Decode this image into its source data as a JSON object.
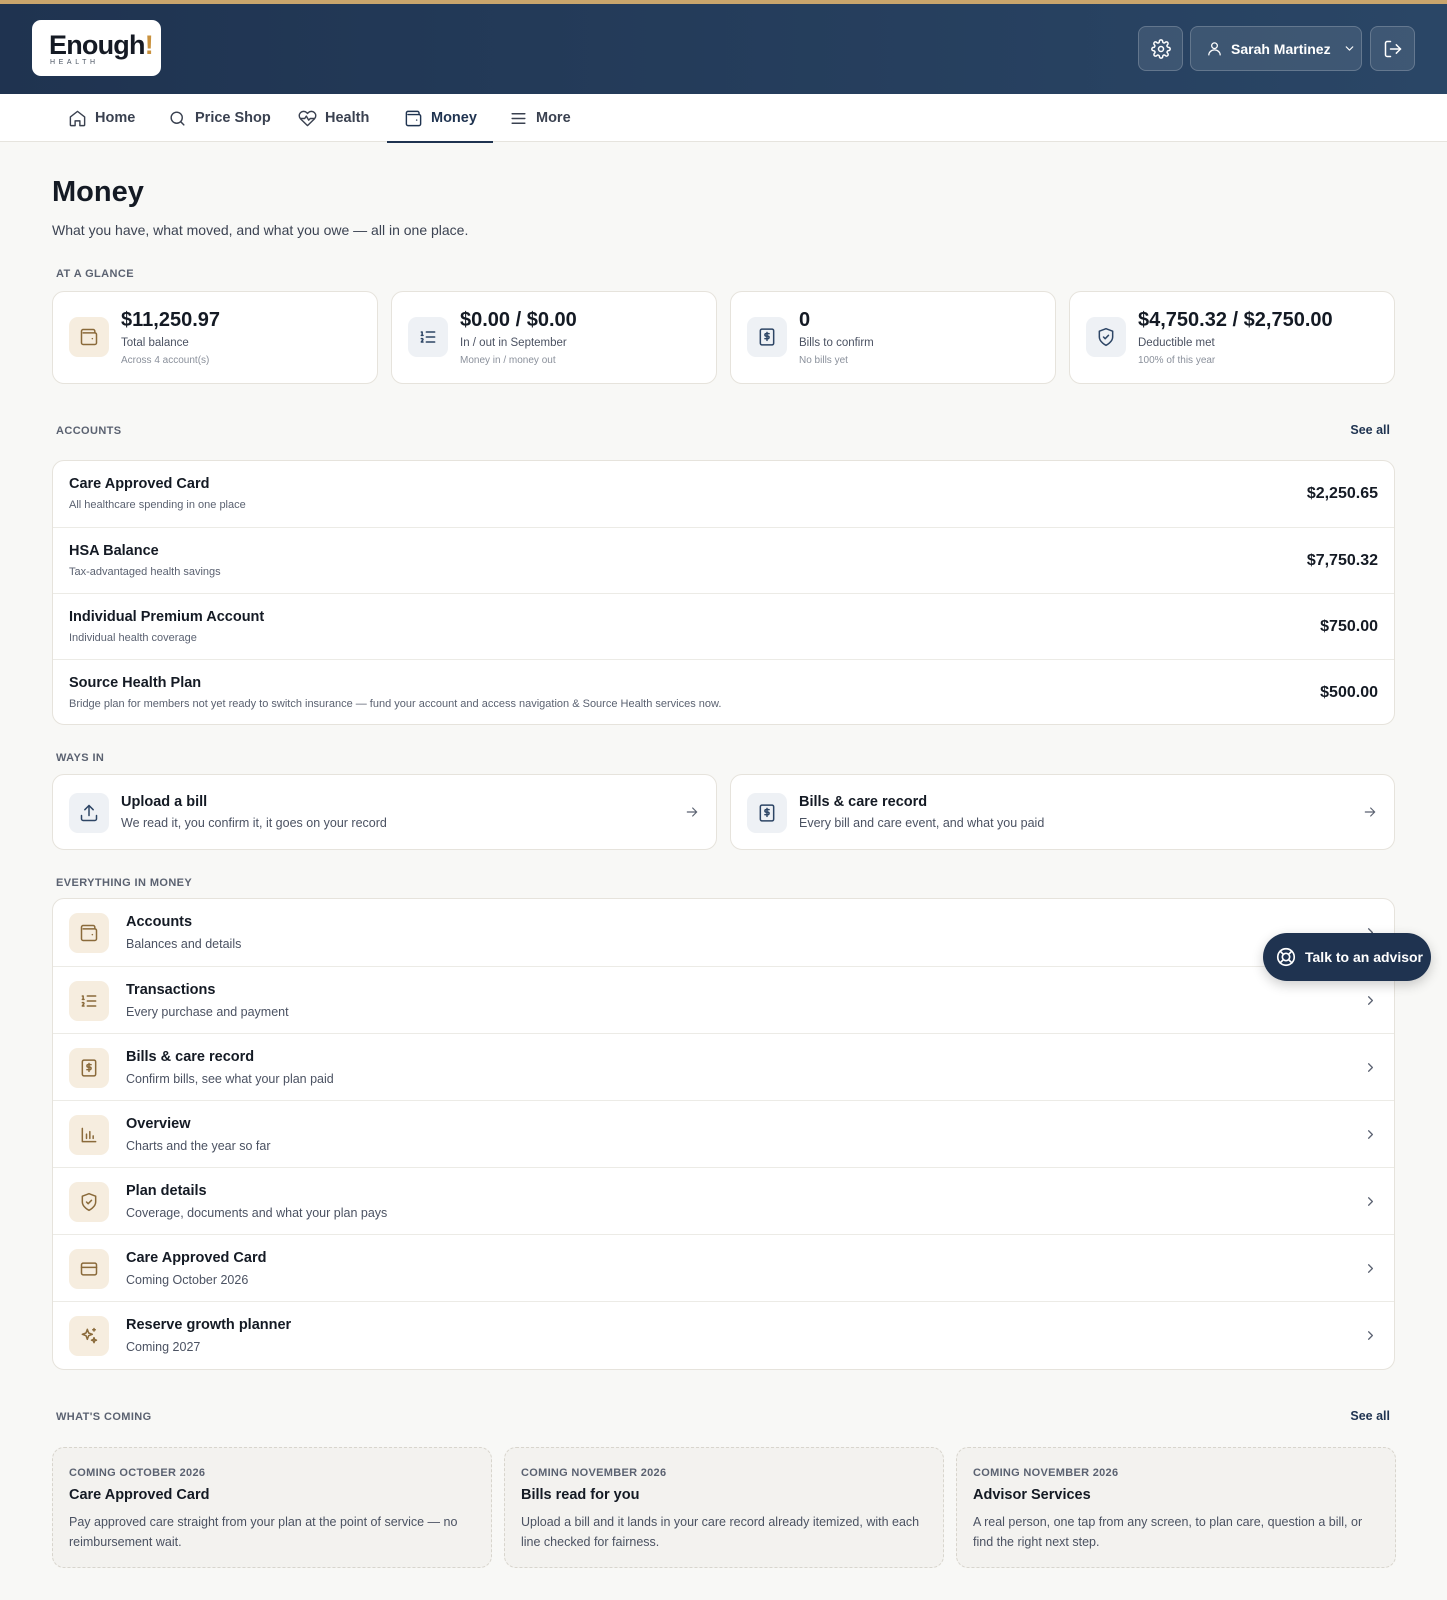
{
  "header": {
    "logo_word": "Enough",
    "logo_bang": "!",
    "logo_sub": "HEALTH",
    "user_name": "Sarah Martinez"
  },
  "nav": {
    "items": [
      {
        "label": "Home",
        "icon": "home-icon"
      },
      {
        "label": "Price Shop",
        "icon": "search-icon"
      },
      {
        "label": "Health",
        "icon": "heart-pulse-icon"
      },
      {
        "label": "Money",
        "icon": "wallet-icon",
        "active": true
      },
      {
        "label": "More",
        "icon": "menu-icon"
      }
    ]
  },
  "page": {
    "title": "Money",
    "subtitle": "What you have, what moved, and what you owe — all in one place."
  },
  "glance": {
    "label": "AT A GLANCE",
    "cards": [
      {
        "value": "$11,250.97",
        "label": "Total balance",
        "sub": "Across 4 account(s)",
        "icon": "wallet-icon"
      },
      {
        "value": "$0.00 / $0.00",
        "label": "In / out in September",
        "sub": "Money in / money out",
        "icon": "list-icon"
      },
      {
        "value": "0",
        "label": "Bills to confirm",
        "sub": "No bills yet",
        "icon": "receipt-icon"
      },
      {
        "value": "$4,750.32 / $2,750.00",
        "label": "Deductible met",
        "sub": "100% of this year",
        "icon": "shield-check-icon"
      }
    ]
  },
  "accounts": {
    "label": "ACCOUNTS",
    "see_all": "See all",
    "rows": [
      {
        "name": "Care Approved Card",
        "desc": "All healthcare spending in one place",
        "amount": "$2,250.65"
      },
      {
        "name": "HSA Balance",
        "desc": "Tax-advantaged health savings",
        "amount": "$7,750.32"
      },
      {
        "name": "Individual Premium Account",
        "desc": "Individual health coverage",
        "amount": "$750.00"
      },
      {
        "name": "Source Health Plan",
        "desc": "Bridge plan for members not yet ready to switch insurance — fund your account and access navigation & Source Health services now.",
        "amount": "$500.00"
      }
    ]
  },
  "ways_in": {
    "label": "WAYS IN",
    "cards": [
      {
        "title": "Upload a bill",
        "sub": "We read it, you confirm it, it goes on your record",
        "icon": "upload-icon"
      },
      {
        "title": "Bills & care record",
        "sub": "Every bill and care event, and what you paid",
        "icon": "receipt-icon"
      }
    ]
  },
  "everything": {
    "label": "EVERYTHING IN MONEY",
    "rows": [
      {
        "title": "Accounts",
        "sub": "Balances and details",
        "icon": "wallet-icon"
      },
      {
        "title": "Transactions",
        "sub": "Every purchase and payment",
        "icon": "list-icon"
      },
      {
        "title": "Bills & care record",
        "sub": "Confirm bills, see what your plan paid",
        "icon": "receipt-icon"
      },
      {
        "title": "Overview",
        "sub": "Charts and the year so far",
        "icon": "bar-chart-icon"
      },
      {
        "title": "Plan details",
        "sub": "Coverage, documents and what your plan pays",
        "icon": "shield-check-icon"
      },
      {
        "title": "Care Approved Card",
        "sub": "Coming October 2026",
        "icon": "credit-card-icon"
      },
      {
        "title": "Reserve growth planner",
        "sub": "Coming 2027",
        "icon": "sparkles-icon"
      }
    ]
  },
  "advisor": {
    "label": "Talk to an advisor",
    "icon": "lifebuoy-icon"
  },
  "coming": {
    "label": "WHAT'S COMING",
    "see_all": "See all",
    "cards": [
      {
        "when": "COMING OCTOBER 2026",
        "title": "Care Approved Card",
        "desc": "Pay approved care straight from your plan at the point of service — no reimbursement wait."
      },
      {
        "when": "COMING NOVEMBER 2026",
        "title": "Bills read for you",
        "desc": "Upload a bill and it lands in your care record already itemized, with each line checked for fairness."
      },
      {
        "when": "COMING NOVEMBER 2026",
        "title": "Advisor Services",
        "desc": "A real person, one tap from any screen, to plan care, question a bill, or find the right next step."
      }
    ]
  },
  "colors": {
    "header_bg": "#1f3350",
    "accent_gold": "#c9a56c",
    "icon_tan_bg": "#f6eddf",
    "icon_blue_bg": "#eef1f5"
  }
}
